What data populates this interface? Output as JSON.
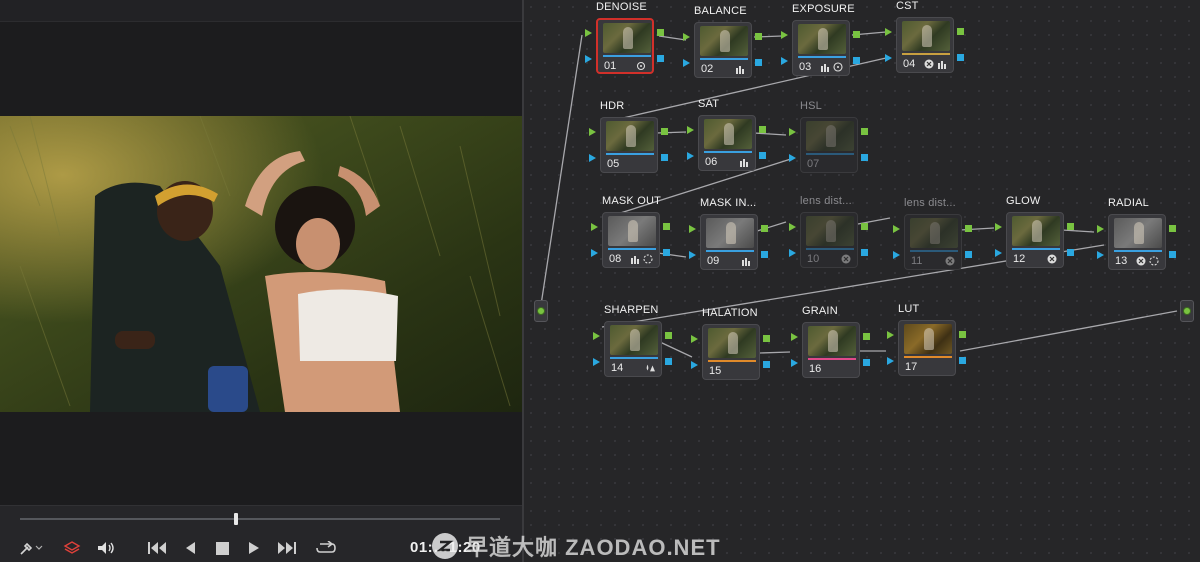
{
  "viewer": {
    "timecode": "01:…1:20",
    "scrubber_position": 0.45
  },
  "toolbar": {
    "icons": [
      "eyedropper-icon",
      "layers-icon",
      "speaker-icon",
      "skip-back-icon",
      "step-back-icon",
      "stop-icon",
      "play-icon",
      "skip-forward-icon",
      "loop-icon"
    ]
  },
  "nodes": [
    {
      "label": "DENOISE",
      "num": "01",
      "selected": true
    },
    {
      "label": "BALANCE",
      "num": "02"
    },
    {
      "label": "EXPOSURE",
      "num": "03"
    },
    {
      "label": "CST",
      "num": "04"
    },
    {
      "label": "HDR",
      "num": "05"
    },
    {
      "label": "SAT",
      "num": "06"
    },
    {
      "label": "HSL",
      "num": "07",
      "disabled": true
    },
    {
      "label": "MASK OUT",
      "num": "08"
    },
    {
      "label": "MASK IN...",
      "num": "09"
    },
    {
      "label": "lens dist...",
      "num": "10",
      "disabled": true
    },
    {
      "label": "lens dist...",
      "num": "11",
      "disabled": true
    },
    {
      "label": "GLOW",
      "num": "12"
    },
    {
      "label": "RADIAL",
      "num": "13"
    },
    {
      "label": "SHARPEN",
      "num": "14"
    },
    {
      "label": "HALATION",
      "num": "15"
    },
    {
      "label": "GRAIN",
      "num": "16"
    },
    {
      "label": "LUT",
      "num": "17"
    }
  ],
  "colors": {
    "rgb_port": "#79c341",
    "key_port": "#2aa8e0",
    "selected_border": "#d2302a"
  },
  "watermark": {
    "text": "早道大咖 ZAODAO.NET"
  }
}
